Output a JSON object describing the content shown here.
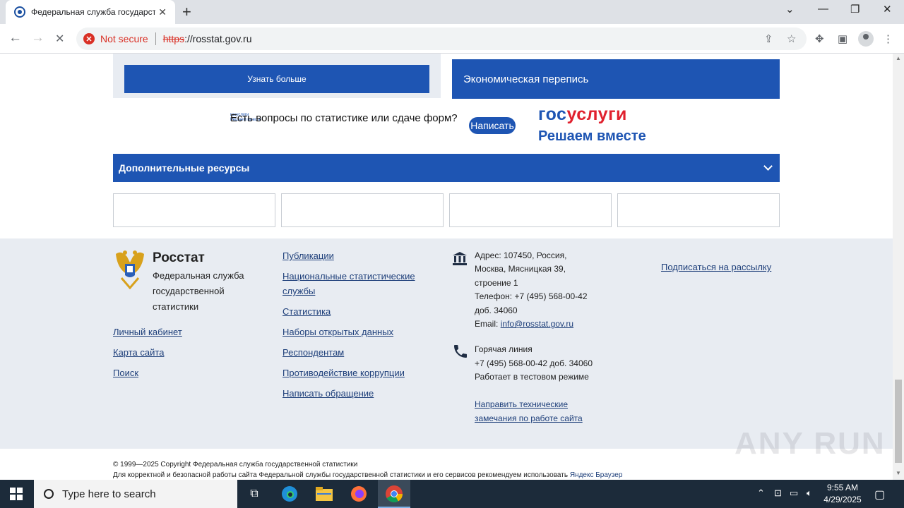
{
  "browser": {
    "tab_title": "Федеральная служба государственной статистики",
    "tab_close": "✕",
    "new_tab": "+",
    "window_controls": {
      "tablist": "⌄",
      "minimize": "—",
      "restore": "❐",
      "close": "✕"
    },
    "nav": {
      "back": "←",
      "forward": "→",
      "reload": "✕"
    },
    "security_label": "Not secure",
    "url_scheme": "https",
    "url_rest": "://rosstat.gov.ru"
  },
  "page": {
    "learn_more": "Узнать больше",
    "census": "Экономическая перепись",
    "question": "Есть вопросы по статистике или сдаче форм?",
    "mini_logo_line1": "госуслуги",
    "mini_logo_line2": "Решаем вместе",
    "write_button": "Написать",
    "gosuslugi_blue": "гос",
    "gosuslugi_red": "услуги",
    "gosuslugi_tagline": "Решаем вместе",
    "additional_resources": "Дополнительные ресурсы"
  },
  "footer": {
    "brand": "Росстат",
    "brand_subtitle": "Федеральная служба государственной статистики",
    "left_links": [
      "Личный кабинет",
      "Карта сайта",
      "Поиск"
    ],
    "middle_links": [
      "Публикации",
      "Национальные статистические службы",
      "Статистика",
      "Наборы открытых данных",
      "Респондентам",
      "Противодействие коррупции",
      "Написать обращение"
    ],
    "address": {
      "line1": "Адрес: 107450, Россия,",
      "line2": "Москва, Мясницкая 39,",
      "line3": "строение 1",
      "phone": "Телефон: +7 (495) 568-00-42",
      "ext": "доб. 34060",
      "email_label": "Email:",
      "email": "info@rosstat.gov.ru"
    },
    "hotline": {
      "title": "Горячая линия",
      "phone": "+7 (495) 568-00-42 доб. 34060",
      "note": "Работает в тестовом режиме"
    },
    "tech_link": "Направить технические замечания по работе сайта",
    "subscribe": "Подписаться на рассылку",
    "copyright": "© 1999—2025 Copyright Федеральная служба государственной статистики",
    "browser_note": "Для корректной и безопасной работы сайта Федеральной службы государственной статистики и его сервисов рекомендуем использовать",
    "browser_note_link": "Яндекс Браузер"
  },
  "watermark": "ANY RUN",
  "taskbar": {
    "search_placeholder": "Type here to search",
    "time": "9:55 AM",
    "date": "4/29/2025"
  },
  "colors": {
    "brand_blue": "#1e55b3",
    "footer_bg": "#e8ecf2",
    "alert_red": "#d93025"
  }
}
